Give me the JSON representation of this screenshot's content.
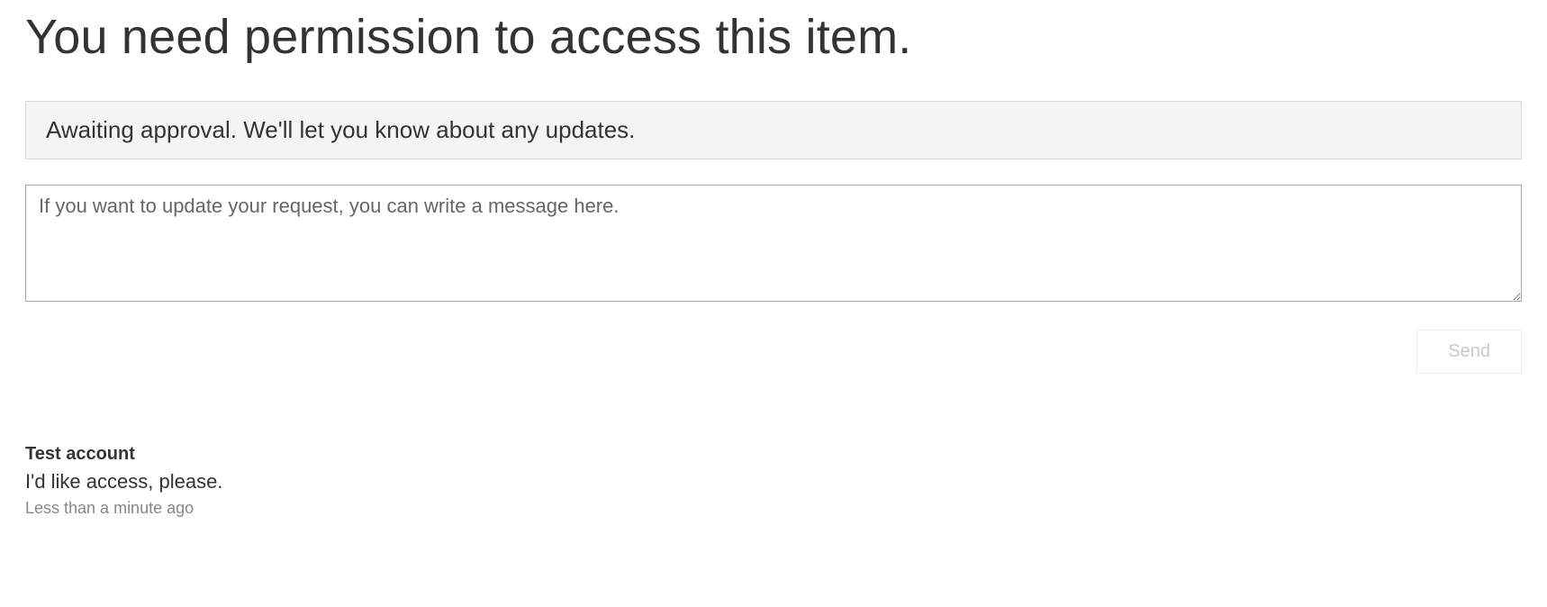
{
  "title": "You need permission to access this item.",
  "status_banner": "Awaiting approval. We'll let you know about any updates.",
  "message_input": {
    "placeholder": "If you want to update your request, you can write a message here.",
    "value": ""
  },
  "send_button_label": "Send",
  "history": [
    {
      "author": "Test account",
      "message": "I'd like access, please.",
      "timestamp": "Less than a minute ago"
    }
  ]
}
